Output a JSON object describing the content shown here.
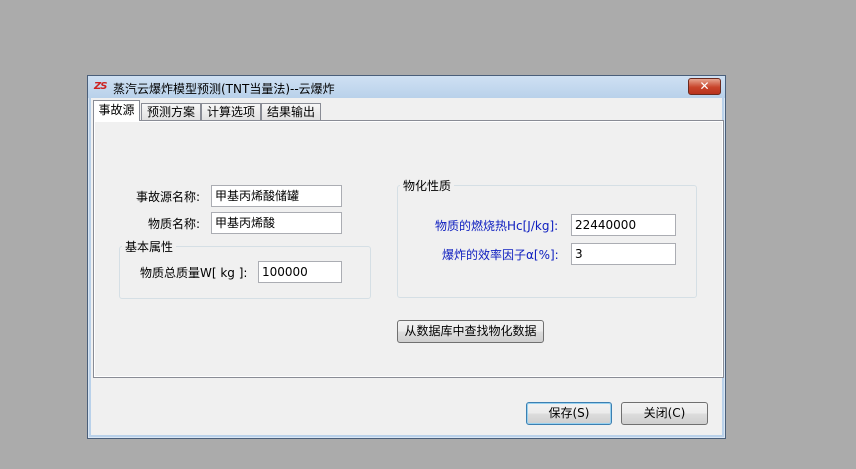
{
  "window": {
    "title": "蒸汽云爆炸模型预测(TNT当量法)--云爆炸",
    "app_icon_text": "ZS",
    "close_glyph": "✕"
  },
  "tabs": [
    {
      "label": "事故源",
      "active": true
    },
    {
      "label": "预测方案",
      "active": false
    },
    {
      "label": "计算选项",
      "active": false
    },
    {
      "label": "结果输出",
      "active": false
    }
  ],
  "source": {
    "accident_source_label": "事故源名称:",
    "accident_source_value": "甲基丙烯酸储罐",
    "substance_label": "物质名称:",
    "substance_value": "甲基丙烯酸"
  },
  "basic_group": {
    "title": "基本属性",
    "mass_label": "物质总质量W[ kg ]:",
    "mass_value": "100000"
  },
  "physchem_group": {
    "title": "物化性质",
    "heat_label": "物质的燃烧热Hc[J/kg]:",
    "heat_value": "22440000",
    "efficiency_label": "爆炸的效率因子α[%]:",
    "efficiency_value": "3"
  },
  "lookup_button": "从数据库中查找物化数据",
  "footer": {
    "save_label": "保存(S)",
    "close_label": "关闭(C)"
  }
}
